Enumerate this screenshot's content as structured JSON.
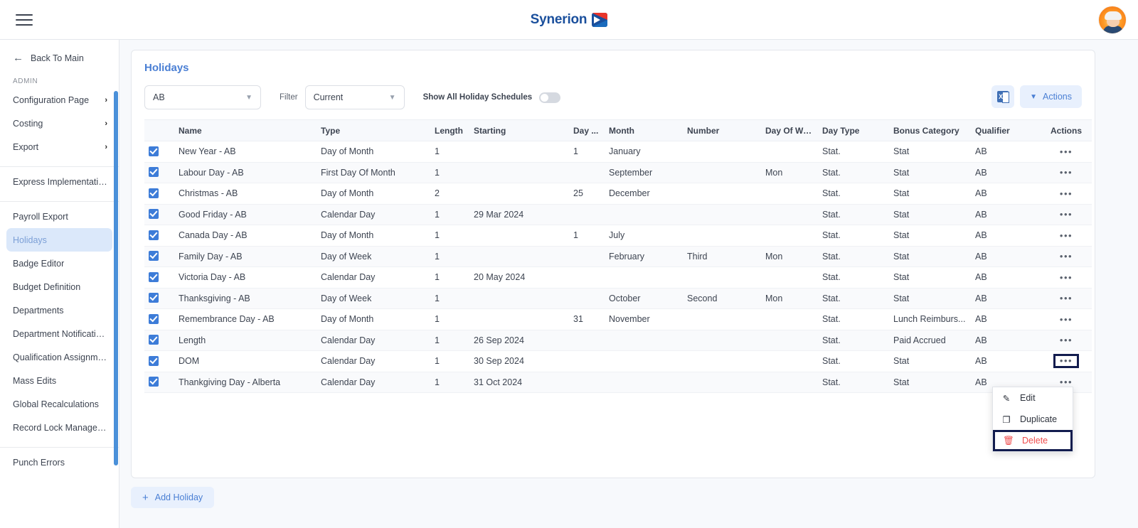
{
  "header": {
    "menu_icon": "hamburger-icon",
    "brand": "Synerion",
    "avatar": "user-avatar"
  },
  "sidebar": {
    "back_label": "Back To Main",
    "section_label": "ADMIN",
    "groups": [
      {
        "items": [
          {
            "label": "Configuration Page",
            "chevron": "›",
            "active": false
          },
          {
            "label": "Costing",
            "chevron": "›",
            "active": false
          },
          {
            "label": "Export",
            "chevron": "›",
            "active": false
          }
        ]
      },
      {
        "items": [
          {
            "label": "Express Implementation P...",
            "chevron": "",
            "active": false
          }
        ]
      },
      {
        "items": [
          {
            "label": "Payroll Export",
            "chevron": "",
            "active": false
          },
          {
            "label": "Holidays",
            "chevron": "",
            "active": true
          },
          {
            "label": "Badge Editor",
            "chevron": "",
            "active": false
          },
          {
            "label": "Budget Definition",
            "chevron": "",
            "active": false
          },
          {
            "label": "Departments",
            "chevron": "",
            "active": false
          },
          {
            "label": "Department Notifications",
            "chevron": "",
            "active": false
          },
          {
            "label": "Qualification Assignments",
            "chevron": "",
            "active": false
          },
          {
            "label": "Mass Edits",
            "chevron": "",
            "active": false
          },
          {
            "label": "Global Recalculations",
            "chevron": "",
            "active": false
          },
          {
            "label": "Record Lock Management",
            "chevron": "",
            "active": false
          }
        ]
      },
      {
        "items": [
          {
            "label": "Punch Errors",
            "chevron": "",
            "active": false
          }
        ]
      }
    ]
  },
  "page": {
    "title": "Holidays"
  },
  "toolbar": {
    "schedule_value": "AB",
    "filter_label": "Filter",
    "filter_value": "Current",
    "toggle_label": "Show All Holiday Schedules",
    "toggle_on": false,
    "export_icon": "excel-export-icon",
    "export_icon_text": "X",
    "actions_label": "Actions",
    "chevron": "⌄"
  },
  "table": {
    "columns": [
      "",
      "Name",
      "Type",
      "Length",
      "Starting",
      "Day ...",
      "Month",
      "Number",
      "Day Of We...",
      "Day Type",
      "Bonus Category",
      "Qualifier",
      "Actions"
    ],
    "rows": [
      {
        "checked": true,
        "name": "New Year - AB",
        "type": "Day of Month",
        "length": "1",
        "starting": "",
        "day": "1",
        "month": "January",
        "number": "",
        "dow": "",
        "daytype": "Stat.",
        "bonus": "Stat",
        "qualifier": "AB"
      },
      {
        "checked": true,
        "name": "Labour Day - AB",
        "type": "First Day Of Month",
        "length": "1",
        "starting": "",
        "day": "",
        "month": "September",
        "number": "",
        "dow": "Mon",
        "daytype": "Stat.",
        "bonus": "Stat",
        "qualifier": "AB"
      },
      {
        "checked": true,
        "name": "Christmas - AB",
        "type": "Day of Month",
        "length": "2",
        "starting": "",
        "day": "25",
        "month": "December",
        "number": "",
        "dow": "",
        "daytype": "Stat.",
        "bonus": "Stat",
        "qualifier": "AB"
      },
      {
        "checked": true,
        "name": "Good Friday - AB",
        "type": "Calendar Day",
        "length": "1",
        "starting": "29 Mar 2024",
        "day": "",
        "month": "",
        "number": "",
        "dow": "",
        "daytype": "Stat.",
        "bonus": "Stat",
        "qualifier": "AB"
      },
      {
        "checked": true,
        "name": "Canada Day - AB",
        "type": "Day of Month",
        "length": "1",
        "starting": "",
        "day": "1",
        "month": "July",
        "number": "",
        "dow": "",
        "daytype": "Stat.",
        "bonus": "Stat",
        "qualifier": "AB"
      },
      {
        "checked": true,
        "name": "Family Day - AB",
        "type": "Day of Week",
        "length": "1",
        "starting": "",
        "day": "",
        "month": "February",
        "number": "Third",
        "dow": "Mon",
        "daytype": "Stat.",
        "bonus": "Stat",
        "qualifier": "AB"
      },
      {
        "checked": true,
        "name": "Victoria Day - AB",
        "type": "Calendar Day",
        "length": "1",
        "starting": "20 May 2024",
        "day": "",
        "month": "",
        "number": "",
        "dow": "",
        "daytype": "Stat.",
        "bonus": "Stat",
        "qualifier": "AB"
      },
      {
        "checked": true,
        "name": "Thanksgiving - AB",
        "type": "Day of Week",
        "length": "1",
        "starting": "",
        "day": "",
        "month": "October",
        "number": "Second",
        "dow": "Mon",
        "daytype": "Stat.",
        "bonus": "Stat",
        "qualifier": "AB"
      },
      {
        "checked": true,
        "name": "Remembrance Day - AB",
        "type": "Day of Month",
        "length": "1",
        "starting": "",
        "day": "31",
        "month": "November",
        "number": "",
        "dow": "",
        "daytype": "Stat.",
        "bonus": "Lunch Reimburs...",
        "qualifier": "AB"
      },
      {
        "checked": true,
        "name": "Length",
        "type": "Calendar Day",
        "length": "1",
        "starting": "26 Sep 2024",
        "day": "",
        "month": "",
        "number": "",
        "dow": "",
        "daytype": "Stat.",
        "bonus": "Paid Accrued",
        "qualifier": "AB"
      },
      {
        "checked": true,
        "name": "DOM",
        "type": "Calendar Day",
        "length": "1",
        "starting": "30 Sep 2024",
        "day": "",
        "month": "",
        "number": "",
        "dow": "",
        "daytype": "Stat.",
        "bonus": "Stat",
        "qualifier": "AB"
      },
      {
        "checked": true,
        "name": "Thankgiving Day - Alberta",
        "type": "Calendar Day",
        "length": "1",
        "starting": "31 Oct 2024",
        "day": "",
        "month": "",
        "number": "",
        "dow": "",
        "daytype": "Stat.",
        "bonus": "Stat",
        "qualifier": "AB"
      }
    ],
    "row_action_glyph": "•••",
    "highlighted_row_index": 10
  },
  "context_menu": {
    "items": [
      {
        "label": "Edit",
        "icon": "pencil-icon",
        "danger": false
      },
      {
        "label": "Duplicate",
        "icon": "copy-icon",
        "danger": false
      },
      {
        "label": "Delete",
        "icon": "trash-icon",
        "danger": true
      }
    ]
  },
  "footer": {
    "add_label": "Add Holiday",
    "add_plus": "+"
  },
  "colors": {
    "brand_blue": "#1a4f9c",
    "accent": "#4a7fd4",
    "checkbox": "#3d7cd8",
    "danger": "#ef4d4d",
    "highlight_outline": "#121c4e",
    "active_nav_bg": "#dbe8fa",
    "scrollbar": "#4a90d9"
  }
}
